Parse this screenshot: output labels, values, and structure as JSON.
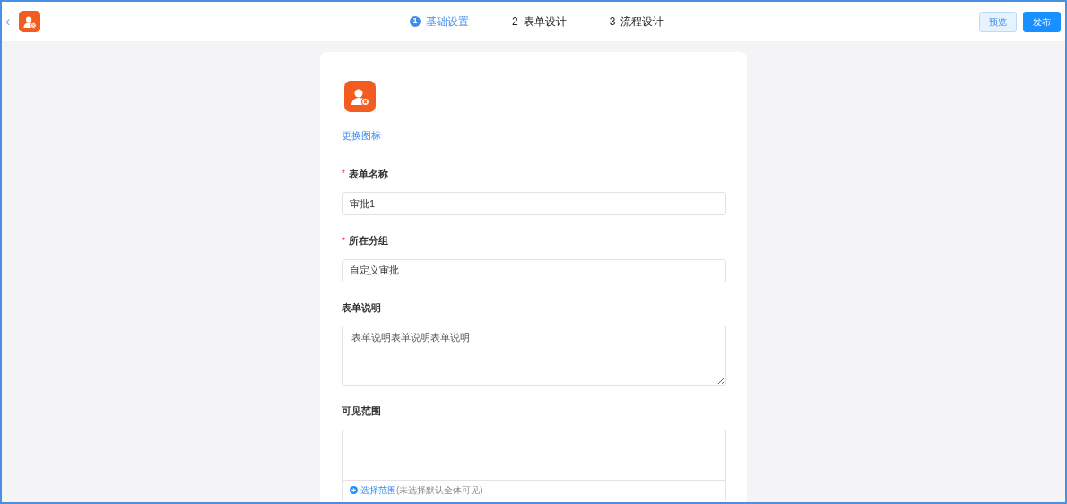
{
  "header": {
    "back": "‹",
    "steps": [
      {
        "number": "1",
        "label": "基础设置",
        "selected": true
      },
      {
        "number": "2",
        "label": "表单设计",
        "selected": false
      },
      {
        "number": "3",
        "label": "流程设计",
        "selected": false
      }
    ],
    "buttons": [
      {
        "label": "预览",
        "kind": "secondary"
      },
      {
        "label": "发布",
        "kind": "primary"
      }
    ]
  },
  "form": {
    "change_icon_link": "更换图标",
    "fields": [
      {
        "kind": "text",
        "required_mark": "*",
        "label": "表单名称",
        "value": "审批1"
      },
      {
        "kind": "text",
        "required_mark": "*",
        "label": "所在分组",
        "value": "自定义审批"
      },
      {
        "kind": "textarea",
        "label": "表单说明",
        "value": "表单说明表单说明表单说明"
      },
      {
        "kind": "scope",
        "label": "可见范围",
        "link": "选择范围",
        "hint": "(未选择默认全体可见)"
      }
    ]
  }
}
